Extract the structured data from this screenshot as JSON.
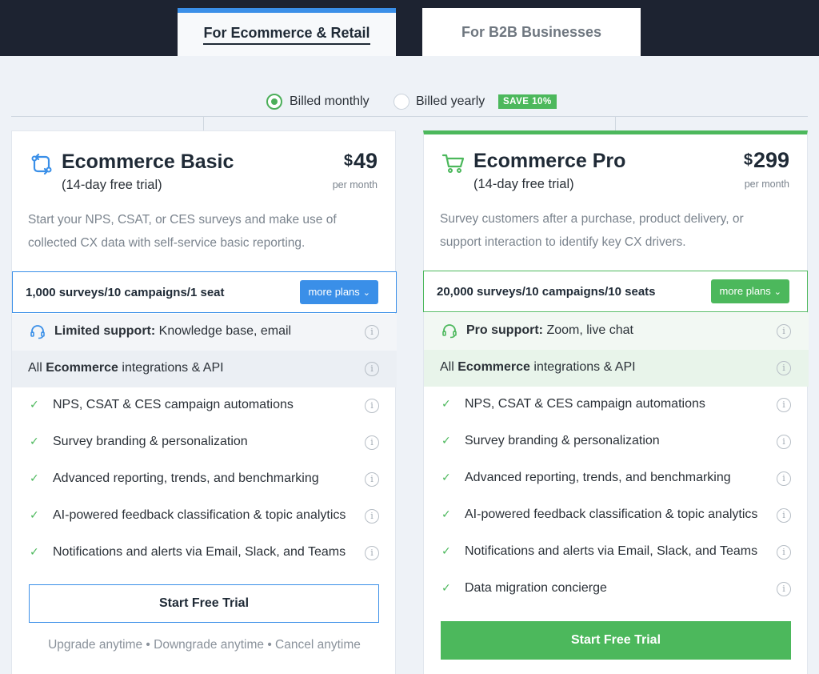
{
  "tabs": [
    {
      "label": "For Ecommerce & Retail",
      "active": true
    },
    {
      "label": "For B2B Businesses",
      "active": false
    }
  ],
  "billing": {
    "monthly_label": "Billed monthly",
    "yearly_label": "Billed yearly",
    "save_badge": "SAVE 10%",
    "selected": "monthly"
  },
  "colors": {
    "accent_blue": "#3a8fe8",
    "accent_green": "#4cb85c",
    "header_dark": "#1d2331"
  },
  "plans": [
    {
      "icon": "arrows-swap-icon",
      "title": "Ecommerce Basic",
      "trial": "(14-day free trial)",
      "currency": "$",
      "price": "49",
      "per": "per month",
      "description": "Start your NPS, CSAT, or CES surveys and make use of collected CX data with self-service basic reporting.",
      "volume": "1,000 surveys/10 campaigns/1 seat",
      "more_plans": "more plans",
      "support_bold": "Limited support:",
      "support_rest": " Knowledge base, email",
      "integrations_pre": "All ",
      "integrations_bold": "Ecommerce",
      "integrations_post": " integrations & API",
      "features": [
        "NPS, CSAT & CES campaign automations",
        "Survey branding & personalization",
        "Advanced reporting, trends, and benchmarking",
        "AI-powered feedback classification & topic analytics",
        "Notifications and alerts via Email, Slack, and Teams"
      ],
      "cta": "Start Free Trial",
      "footnote": "Upgrade anytime • Downgrade anytime • Cancel anytime"
    },
    {
      "icon": "shopping-cart-icon",
      "title": "Ecommerce Pro",
      "trial": "(14-day free trial)",
      "currency": "$",
      "price": "299",
      "per": "per month",
      "description": "Survey customers after a purchase, product delivery, or support interaction to identify key CX drivers.",
      "volume": "20,000 surveys/10 campaigns/10 seats",
      "more_plans": "more plans",
      "support_bold": "Pro support:",
      "support_rest": " Zoom, live chat",
      "integrations_pre": "All ",
      "integrations_bold": "Ecommerce",
      "integrations_post": " integrations & API",
      "features": [
        "NPS, CSAT & CES campaign automations",
        "Survey branding & personalization",
        "Advanced reporting, trends, and benchmarking",
        "AI-powered feedback classification & topic analytics",
        "Notifications and alerts via Email, Slack, and Teams",
        "Data migration concierge"
      ],
      "cta": "Start Free Trial"
    }
  ],
  "info_glyph": "i",
  "check_glyph": "✓",
  "chevron_glyph": "⌄"
}
